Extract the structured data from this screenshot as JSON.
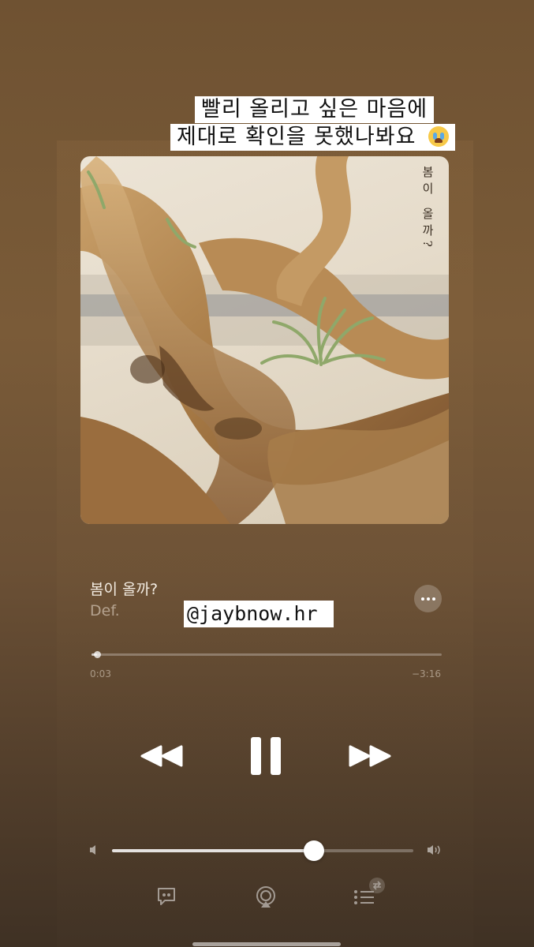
{
  "story": {
    "caption_line1": "빨리 올리고 싶은 마음에",
    "caption_line2": "제대로 확인을 못했나봐요",
    "caption_emoji": "loudly-crying-face-emoji",
    "mention": "@jaybnow.hr"
  },
  "now_playing": {
    "artwork_title": "봄이 올까?",
    "song_title": "봄이 올까?",
    "artist": "Def.",
    "elapsed": "0:03",
    "remaining": "−3:16",
    "progress_fraction": 0.015,
    "volume_fraction": 0.67
  },
  "controls": {
    "rewind_icon": "rewind-icon",
    "pause_icon": "pause-icon",
    "forward_icon": "fast-forward-icon",
    "more_icon": "more-icon",
    "volume_low_icon": "volume-low-icon",
    "volume_high_icon": "volume-high-icon",
    "lyrics_icon": "lyrics-icon",
    "airplay_icon": "airplay-icon",
    "queue_icon": "queue-icon"
  },
  "colors": {
    "background_top": "#6f5232",
    "background_bottom": "#3f3124",
    "text_primary": "#f3ece2"
  }
}
